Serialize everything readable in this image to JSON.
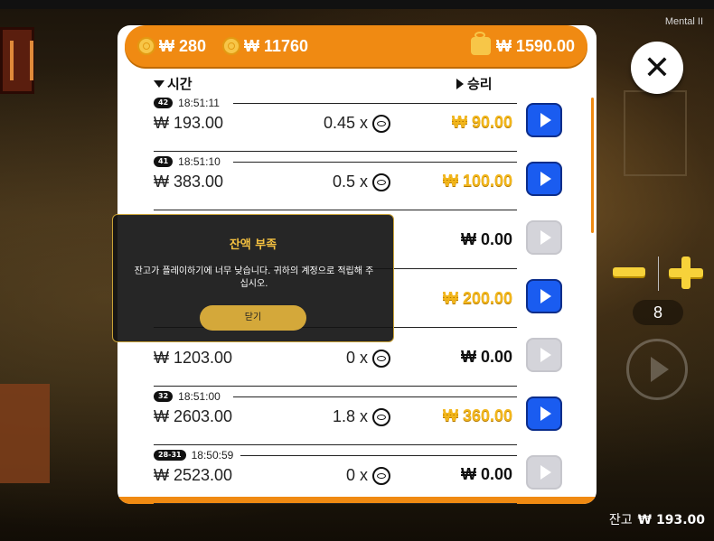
{
  "game": {
    "title": "Mental II"
  },
  "header": {
    "coin1": "₩ 280",
    "coin2": "₩ 11760",
    "wallet": "₩ 1590.00"
  },
  "columns": {
    "time": "시간",
    "win": "승리"
  },
  "rows": [
    {
      "round": "42",
      "time": "18:51:11",
      "bet": "₩ 193.00",
      "mult": "0.45 x",
      "win": "₩ 90.00",
      "won": true
    },
    {
      "round": "41",
      "time": "18:51:10",
      "bet": "₩ 383.00",
      "mult": "0.5 x",
      "win": "₩ 100.00",
      "won": true
    },
    {
      "round": "",
      "time": "",
      "bet": "",
      "mult": "",
      "win": "₩ 0.00",
      "won": false
    },
    {
      "round": "",
      "time": "",
      "bet": "",
      "mult": "",
      "win": "₩ 200.00",
      "won": true
    },
    {
      "round": "",
      "time": "",
      "bet": "₩ 1203.00",
      "mult": "0 x",
      "win": "₩ 0.00",
      "won": false
    },
    {
      "round": "32",
      "time": "18:51:00",
      "bet": "₩ 2603.00",
      "mult": "1.8 x",
      "win": "₩ 360.00",
      "won": true
    },
    {
      "round": "28-31",
      "time": "18:50:59",
      "bet": "₩ 2523.00",
      "mult": "0 x",
      "win": "₩ 0.00",
      "won": false
    }
  ],
  "controls": {
    "count": "8"
  },
  "balance": {
    "label": "잔고",
    "value": "₩ 193.00"
  },
  "modal": {
    "title": "잔액 부족",
    "message": "잔고가 플레이하기에 너무 낮습니다. 귀하의 계정으로 적립해 주십시오.",
    "button": "닫기"
  },
  "colors": {
    "accent": "#f08a12",
    "win": "#f2b61b",
    "play": "#1a5cf0"
  }
}
